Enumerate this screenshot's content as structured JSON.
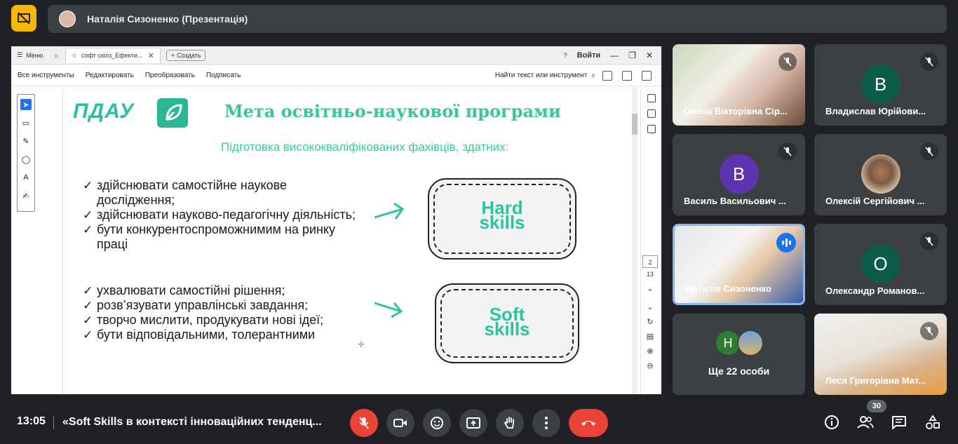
{
  "presenter": {
    "name": "Наталія Сизоненко (Презентація)"
  },
  "viewer": {
    "menu_label": "Меню",
    "tab_title": "софт скілз_Ефекти...",
    "new_label": "Создать",
    "login_label": "Войти",
    "tools": [
      "Все инструменты",
      "Редактировать",
      "Преобразовать",
      "Подписать"
    ],
    "find_label": "Найти текст или инструмент",
    "page_current": "2",
    "page_total": "13"
  },
  "slide": {
    "logo": "ПДАУ",
    "title": "Мета освітньо-наукової програми",
    "subtitle": "Підготовка висококваліфікованих фахівців, здатних:",
    "list1": [
      "здійснювати самостійне наукове дослідження;",
      "здійснювати науково-педагогічну діяльність;",
      "бути конкурентоспроможнимим на ринку праці"
    ],
    "list2": [
      "ухвалювати самостійні рішення;",
      "розв’язувати управлінські завдання;",
      "творчо мислити, продукувати нові ідеї;",
      "бути відповідальними, толерантними"
    ],
    "hard_line1": "Hard",
    "hard_line2": "skills",
    "soft_line1": "Soft",
    "soft_line2": "skills"
  },
  "participants": [
    {
      "name": "Олена Вікторівна Сір...",
      "type": "photo",
      "muted": true
    },
    {
      "name": "Владислав Юрійови...",
      "initial": "В",
      "color": "#0b5d4a",
      "muted": true
    },
    {
      "name": "Василь Васильович ...",
      "initial": "В",
      "color": "#5e35b1",
      "muted": true
    },
    {
      "name": "Олексій Сергійович ...",
      "type": "photo",
      "muted": true
    },
    {
      "name": "Наталія Сизоненко",
      "type": "photo",
      "speaking": true
    },
    {
      "name": "Олександр Романов...",
      "initial": "О",
      "color": "#0b5d4a",
      "muted": true
    },
    {
      "name": "Леся Григорівна Мат...",
      "type": "photo",
      "muted": true
    }
  ],
  "others": {
    "label": "Ще 22 особи",
    "initial": "Н",
    "color": "#2e7d32"
  },
  "bottom": {
    "time": "13:05",
    "title": "«Soft Skills в контексті інноваційних тенденц...",
    "participants_count": "30"
  },
  "colors": {
    "accent": "#37c59e",
    "danger": "#ea4335",
    "tile_bg": "#3c4043",
    "bg": "#202124"
  }
}
